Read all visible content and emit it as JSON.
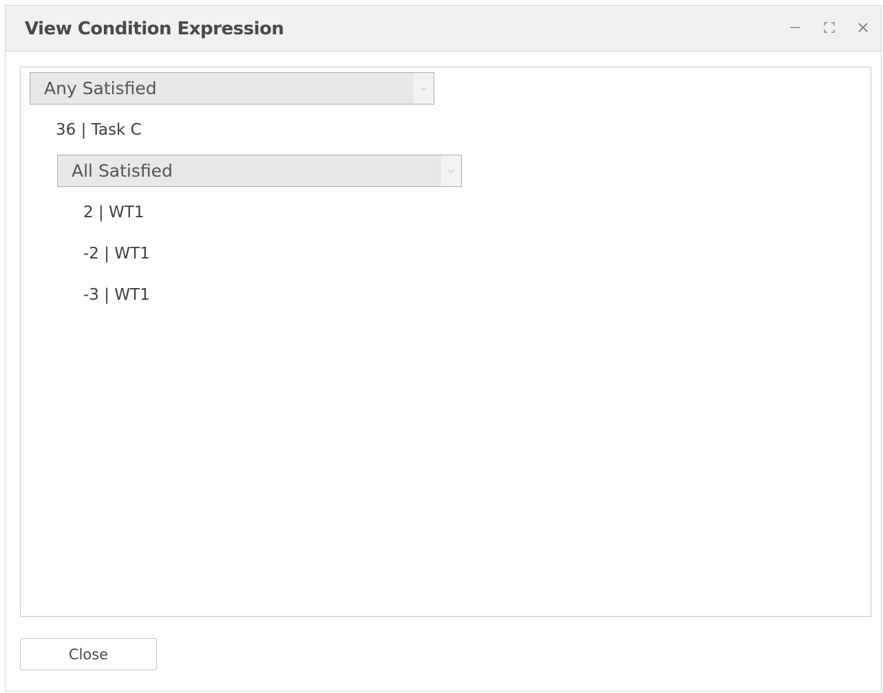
{
  "window": {
    "title": "View Condition Expression",
    "controls": {
      "minimize": "minimize-icon",
      "maximize": "maximize-icon",
      "close": "close-icon"
    }
  },
  "expression": {
    "root_operator": "Any Satisfied",
    "group": {
      "task_label": "36 | Task C",
      "operator": "All Satisfied",
      "items": [
        "2 | WT1",
        "-2 | WT1",
        "-3 | WT1"
      ]
    }
  },
  "footer": {
    "close_label": "Close"
  },
  "colors": {
    "titlebar_bg": "#f1f1f1",
    "select_bg": "#e8e8e8",
    "border": "#c8c8c8",
    "text": "#3f3f3f"
  }
}
